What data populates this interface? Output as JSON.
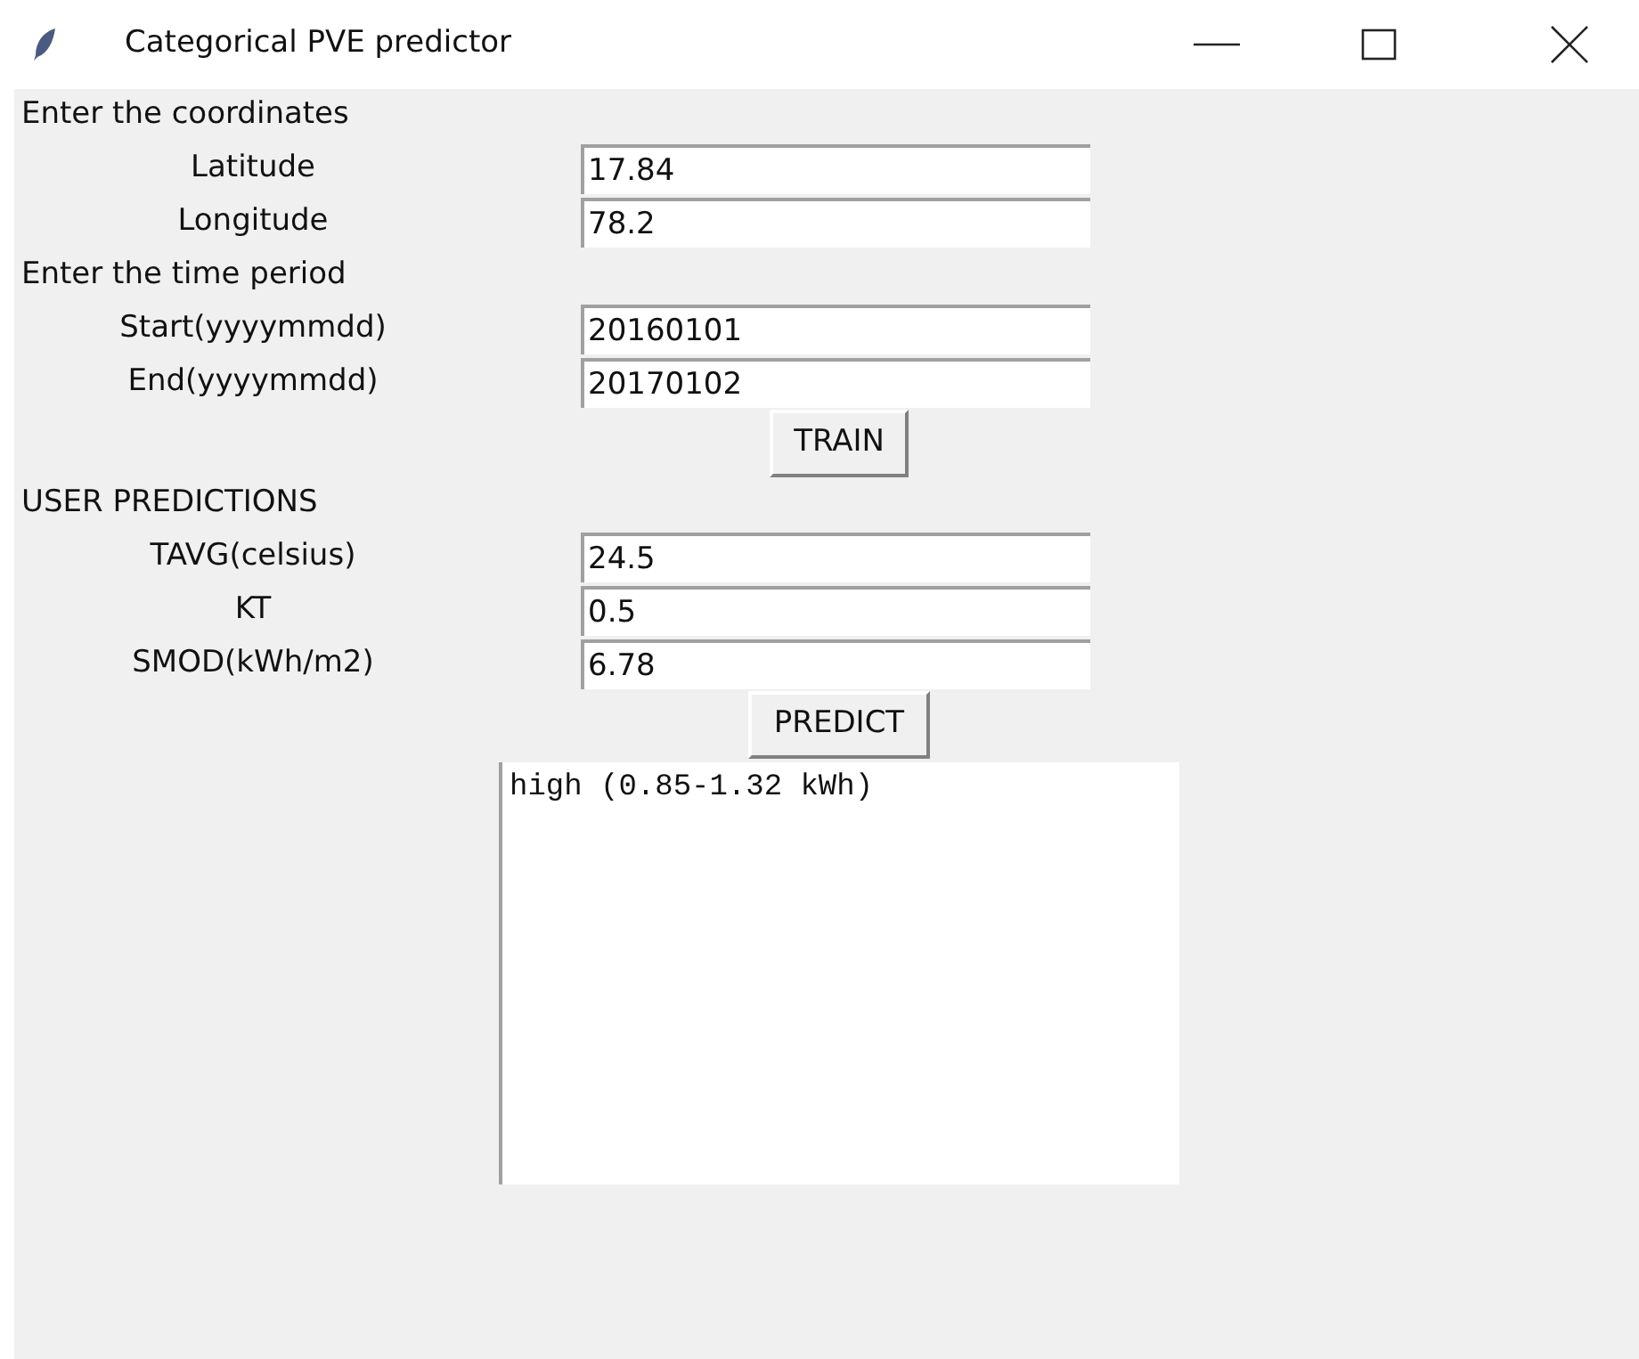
{
  "window": {
    "title": "Categorical PVE predictor"
  },
  "items": [
    {
      "kind": "heading",
      "text": "Enter the coordinates"
    },
    {
      "kind": "field",
      "label": "Latitude",
      "value": "17.84"
    },
    {
      "kind": "field",
      "label": "Longitude",
      "value": "78.2"
    },
    {
      "kind": "heading",
      "text": "Enter the time period"
    },
    {
      "kind": "field",
      "label": "Start(yyyymmdd)",
      "value": "20160101"
    },
    {
      "kind": "field",
      "label": "End(yyyymmdd)",
      "value": "20170102"
    },
    {
      "kind": "button",
      "text": "TRAIN"
    },
    {
      "kind": "heading",
      "text": "USER PREDICTIONS"
    },
    {
      "kind": "field",
      "label": "TAVG(celsius)",
      "value": "24.5"
    },
    {
      "kind": "field",
      "label": "KT",
      "value": "0.5"
    },
    {
      "kind": "field",
      "label": "SMOD(kWh/m2)",
      "value": "6.78"
    },
    {
      "kind": "button",
      "text": "PREDICT"
    },
    {
      "kind": "output",
      "text": "high (0.85-1.32 kWh)"
    }
  ]
}
